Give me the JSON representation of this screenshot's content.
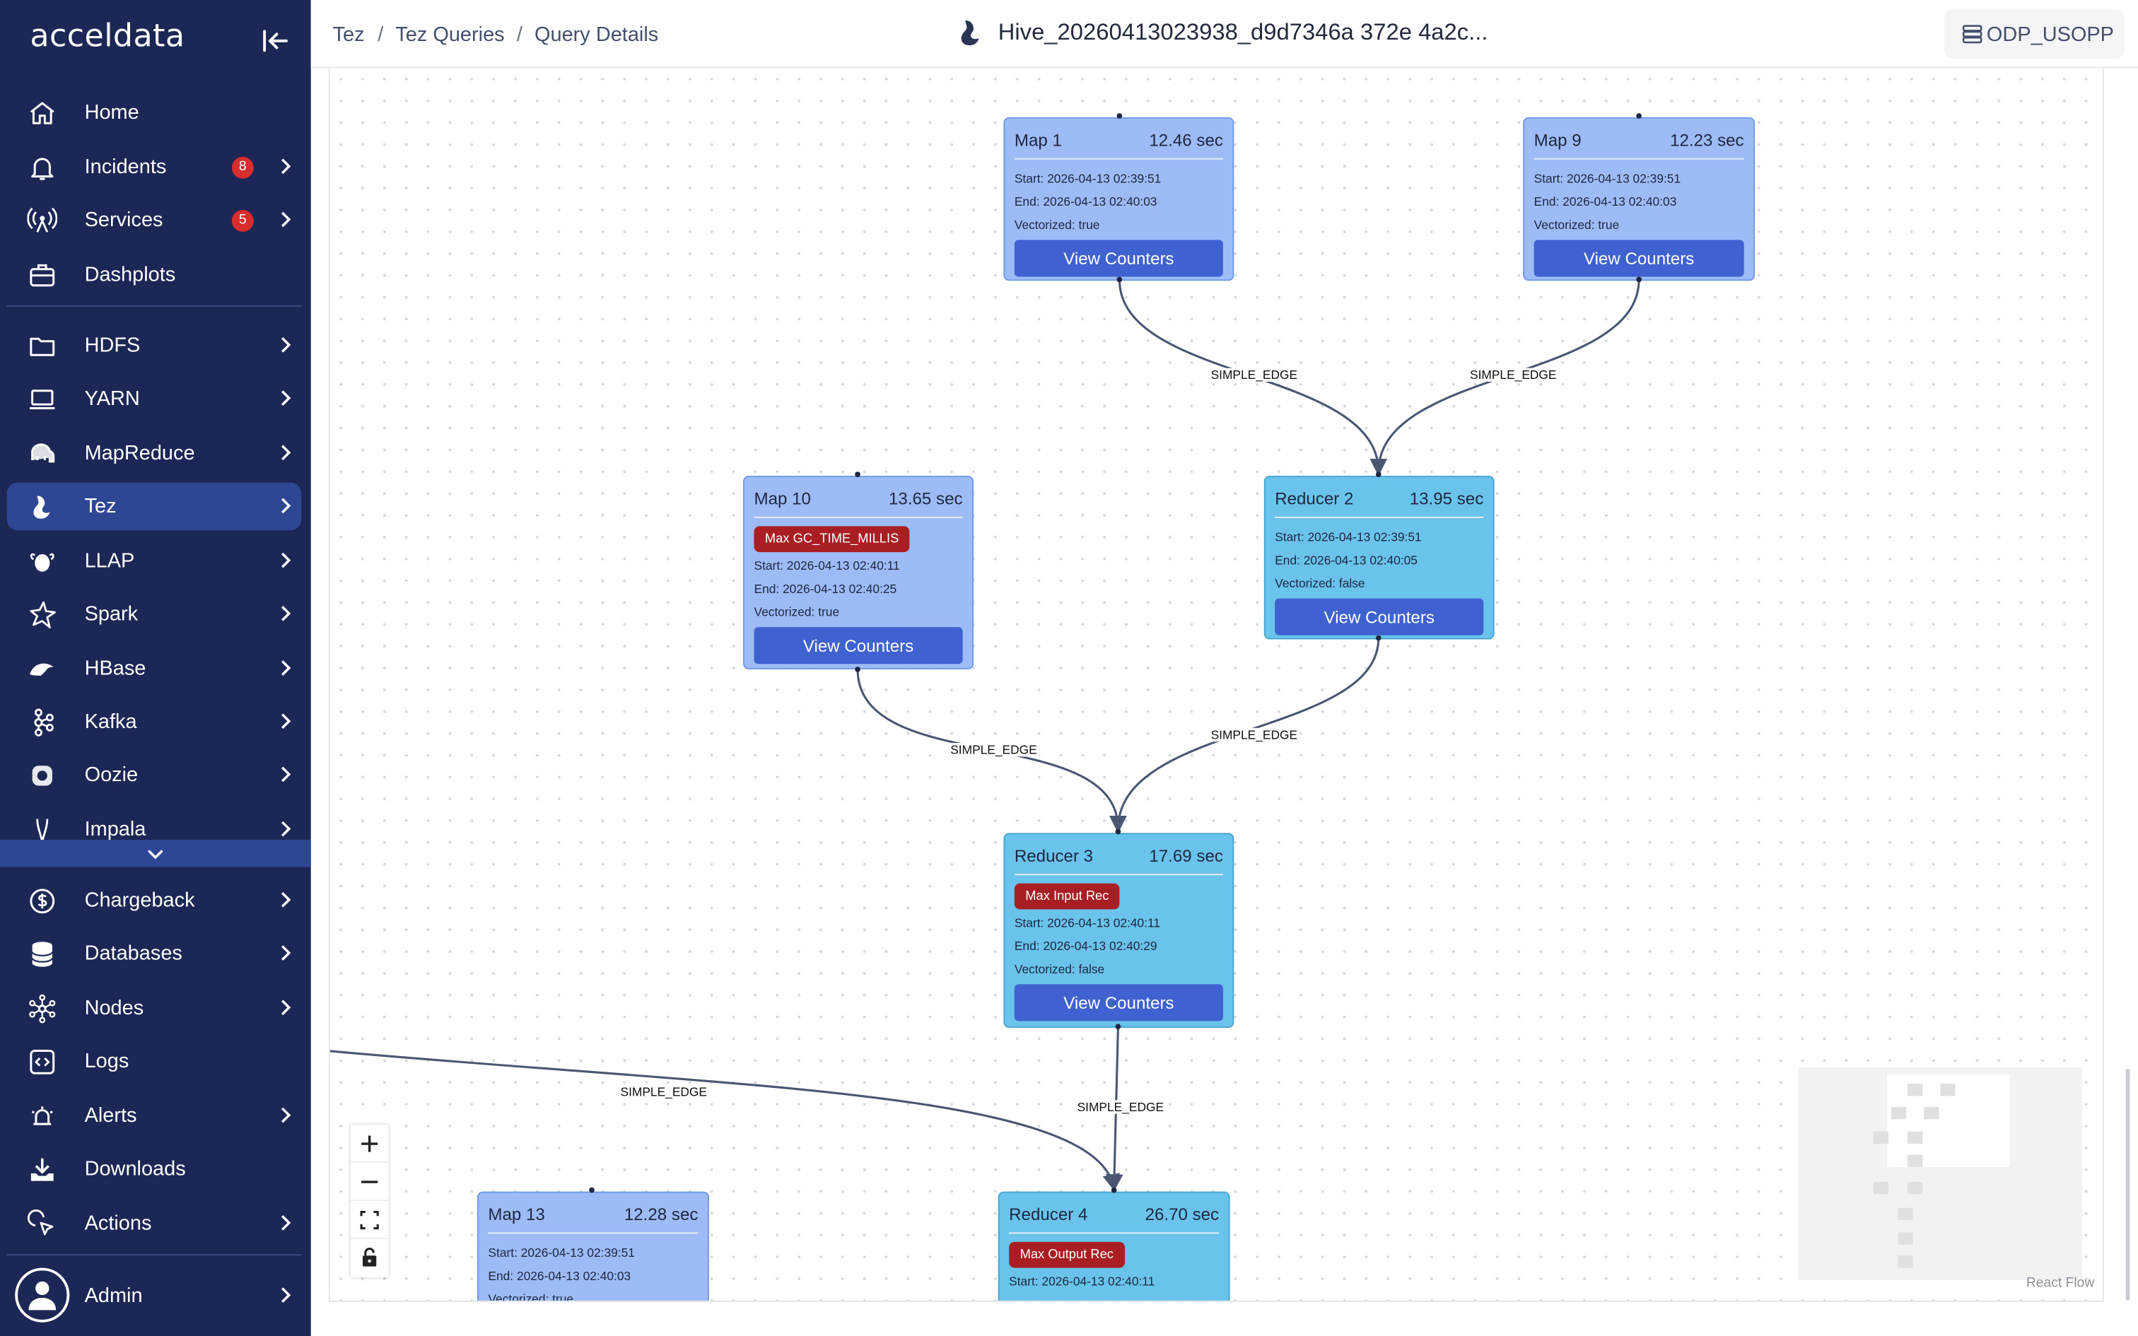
{
  "app": {
    "logo": "acceldata"
  },
  "sidebar": {
    "items": [
      {
        "label": "Home",
        "icon": "home-icon"
      },
      {
        "label": "Incidents",
        "icon": "bell-icon",
        "badge": "8"
      },
      {
        "label": "Services",
        "icon": "broadcast-icon",
        "badge": "5"
      },
      {
        "label": "Dashplots",
        "icon": "briefcase-icon"
      },
      {
        "label": "HDFS",
        "icon": "folder-icon"
      },
      {
        "label": "YARN",
        "icon": "laptop-icon"
      },
      {
        "label": "MapReduce",
        "icon": "elephant-icon"
      },
      {
        "label": "Tez",
        "icon": "tez-icon"
      },
      {
        "label": "LLAP",
        "icon": "bee-icon"
      },
      {
        "label": "Spark",
        "icon": "spark-icon"
      },
      {
        "label": "HBase",
        "icon": "orca-icon"
      },
      {
        "label": "Kafka",
        "icon": "kafka-icon"
      },
      {
        "label": "Oozie",
        "icon": "oozie-icon"
      },
      {
        "label": "Impala",
        "icon": "impala-icon"
      },
      {
        "label": "Chargeback",
        "icon": "dollar-icon"
      },
      {
        "label": "Databases",
        "icon": "database-icon"
      },
      {
        "label": "Nodes",
        "icon": "nodes-icon"
      },
      {
        "label": "Logs",
        "icon": "code-icon"
      },
      {
        "label": "Alerts",
        "icon": "alarm-icon"
      },
      {
        "label": "Downloads",
        "icon": "download-icon"
      },
      {
        "label": "Actions",
        "icon": "cursor-click-icon"
      }
    ],
    "admin": {
      "label": "Admin",
      "icon": "user-icon"
    }
  },
  "header": {
    "breadcrumbs": [
      "Tez",
      "Tez Queries",
      "Query Details"
    ],
    "title": "Hive_20260413023938_d9d7346a 372e 4a2c...",
    "cluster": "ODP_USOPP"
  },
  "graph": {
    "button_label": "View Counters",
    "edge_label": "SIMPLE_EDGE",
    "nodes": [
      {
        "name": "Map 1",
        "duration": "12.46 sec",
        "start": "Start: 2026-04-13 02:39:51",
        "end": "End: 2026-04-13 02:40:03",
        "vectorized": "Vectorized: true"
      },
      {
        "name": "Map 9",
        "duration": "12.23 sec",
        "start": "Start: 2026-04-13 02:39:51",
        "end": "End: 2026-04-13 02:40:03",
        "vectorized": "Vectorized: true"
      },
      {
        "name": "Map 10",
        "duration": "13.65 sec",
        "badge": "Max GC_TIME_MILLIS",
        "start": "Start: 2026-04-13 02:40:11",
        "end": "End: 2026-04-13 02:40:25",
        "vectorized": "Vectorized: true"
      },
      {
        "name": "Reducer 2",
        "duration": "13.95 sec",
        "start": "Start: 2026-04-13 02:39:51",
        "end": "End: 2026-04-13 02:40:05",
        "vectorized": "Vectorized: false"
      },
      {
        "name": "Reducer 3",
        "duration": "17.69 sec",
        "badge": "Max Input Rec",
        "start": "Start: 2026-04-13 02:40:11",
        "end": "End: 2026-04-13 02:40:29",
        "vectorized": "Vectorized: false"
      },
      {
        "name": "Map 13",
        "duration": "12.28 sec",
        "start": "Start: 2026-04-13 02:39:51",
        "end": "End: 2026-04-13 02:40:03",
        "vectorized": "Vectorized: true"
      },
      {
        "name": "Reducer 4",
        "duration": "26.70 sec",
        "badge": "Max Output Rec",
        "start": "Start: 2026-04-13 02:40:11"
      }
    ]
  },
  "flow": {
    "attribution": "React Flow"
  },
  "colors": {
    "sidebar_bg": "#1c2755",
    "sidebar_active": "#2e4795",
    "map_node": "#9dbbf6",
    "reducer_node": "#69c3ea",
    "button": "#3f62d0",
    "alert_badge": "#a91e22"
  }
}
